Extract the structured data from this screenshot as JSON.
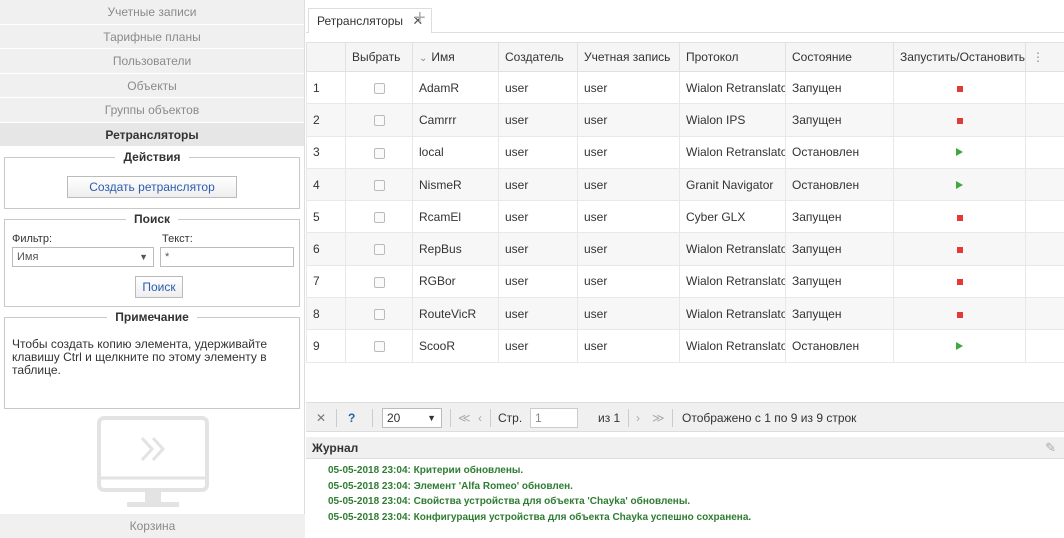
{
  "sidebar": {
    "nav": [
      {
        "label": "Учетные записи"
      },
      {
        "label": "Тарифные планы"
      },
      {
        "label": "Пользователи"
      },
      {
        "label": "Объекты"
      },
      {
        "label": "Группы объектов"
      },
      {
        "label": "Ретрансляторы"
      }
    ],
    "actions": {
      "legend": "Действия",
      "create_button": "Создать ретранслятор"
    },
    "search": {
      "legend": "Поиск",
      "filter_label": "Фильтр:",
      "filter_value": "Имя",
      "text_label": "Текст:",
      "text_value": "*",
      "search_button": "Поиск"
    },
    "note": {
      "legend": "Примечание",
      "text": "Чтобы создать копию элемента, удерживайте клавишу Ctrl и щелкните по этому элементу в таблице."
    },
    "trash_label": "Корзина"
  },
  "tabs": {
    "active": "Ретрансляторы",
    "close": "✕",
    "add": "+"
  },
  "table": {
    "headers": {
      "select": "Выбрать",
      "name": "Имя",
      "creator": "Создатель",
      "account": "Учетная запись",
      "protocol": "Протокол",
      "state": "Состояние",
      "startstop": "Запустить/Остановить"
    },
    "sort_indicator": "⌄",
    "rows": [
      {
        "n": "1",
        "name": "AdamR",
        "creator": "user",
        "account": "user",
        "protocol": "Wialon Retranslato",
        "state": "Запущен",
        "action": "stop"
      },
      {
        "n": "2",
        "name": "Camrrr",
        "creator": "user",
        "account": "user",
        "protocol": "Wialon IPS",
        "state": "Запущен",
        "action": "stop"
      },
      {
        "n": "3",
        "name": "local",
        "creator": "user",
        "account": "user",
        "protocol": "Wialon Retranslato",
        "state": "Остановлен",
        "action": "play"
      },
      {
        "n": "4",
        "name": "NismeR",
        "creator": "user",
        "account": "user",
        "protocol": "Granit Navigator",
        "state": "Остановлен",
        "action": "play"
      },
      {
        "n": "5",
        "name": "RcamEl",
        "creator": "user",
        "account": "user",
        "protocol": "Cyber GLX",
        "state": "Запущен",
        "action": "stop"
      },
      {
        "n": "6",
        "name": "RepBus",
        "creator": "user",
        "account": "user",
        "protocol": "Wialon Retranslato",
        "state": "Запущен",
        "action": "stop"
      },
      {
        "n": "7",
        "name": "RGBor",
        "creator": "user",
        "account": "user",
        "protocol": "Wialon Retranslato",
        "state": "Запущен",
        "action": "stop"
      },
      {
        "n": "8",
        "name": "RouteVicR",
        "creator": "user",
        "account": "user",
        "protocol": "Wialon Retranslato",
        "state": "Запущен",
        "action": "stop"
      },
      {
        "n": "9",
        "name": "ScooR",
        "creator": "user",
        "account": "user",
        "protocol": "Wialon Retranslato",
        "state": "Остановлен",
        "action": "play"
      }
    ],
    "stop_color": "#e03b3b",
    "play_color": "#3fa93f"
  },
  "pager": {
    "close": "✕",
    "help": "?",
    "page_size": "20",
    "first": "≪",
    "prev": "‹",
    "page_label": "Стр.",
    "page_value": "1",
    "of_label": "из 1",
    "next": "›",
    "last": "≫",
    "status": "Отображено с 1 по 9 из 9 строк"
  },
  "log": {
    "title": "Журнал",
    "lines": [
      "05-05-2018 23:04: Критерии обновлены.",
      "05-05-2018 23:04: Элемент 'Alfa Romeo' обновлен.",
      "05-05-2018 23:04: Свойства устройства для объекта 'Chayka' обновлены.",
      "05-05-2018 23:04: Конфигурация устройства для объекта Chayka успешно сохранена."
    ],
    "line_color": "#2e7d32"
  }
}
